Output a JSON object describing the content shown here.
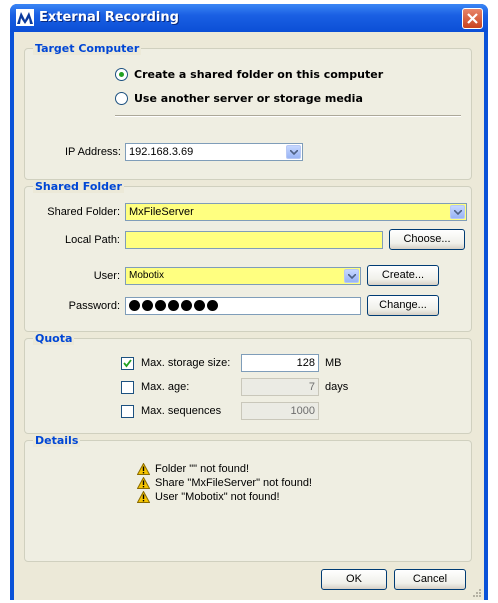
{
  "window": {
    "title": "External Recording"
  },
  "target_computer": {
    "legend": "Target Computer",
    "option_shared": "Create a shared folder on this computer",
    "option_other": "Use another server or storage media",
    "ip_label": "IP Address:",
    "ip_value": "192.168.3.69"
  },
  "shared_folder": {
    "legend": "Shared Folder",
    "folder_label": "Shared Folder:",
    "folder_value": "MxFileServer",
    "local_path_label": "Local Path:",
    "local_path_value": "",
    "choose_label": "Choose...",
    "user_label": "User:",
    "user_value": "Mobotix",
    "create_label": "Create...",
    "password_label": "Password:",
    "password_mask_count": 7,
    "change_label": "Change..."
  },
  "quota": {
    "legend": "Quota",
    "max_storage_label": "Max. storage size:",
    "max_storage_checked": true,
    "max_storage_value": "128",
    "max_storage_unit": "MB",
    "max_age_label": "Max. age:",
    "max_age_checked": false,
    "max_age_value": "7",
    "max_age_unit": "days",
    "max_seq_label": "Max. sequences",
    "max_seq_checked": false,
    "max_seq_value": "1000"
  },
  "details": {
    "legend": "Details",
    "messages": [
      "Folder \"\" not found!",
      "Share \"MxFileServer\" not found!",
      "User \"Mobotix\" not found!"
    ]
  },
  "buttons": {
    "ok": "OK",
    "cancel": "Cancel"
  },
  "colors": {
    "title_bar": "#0b4fd6",
    "legend_text": "#0046d5",
    "required_field": "#ffff80",
    "radio_dot": "#21a121",
    "warning": "#f5c400"
  },
  "icons": {
    "app": "mobotix-logo-icon",
    "close": "close-icon",
    "warning": "warning-icon",
    "dropdown": "chevron-down-icon"
  }
}
